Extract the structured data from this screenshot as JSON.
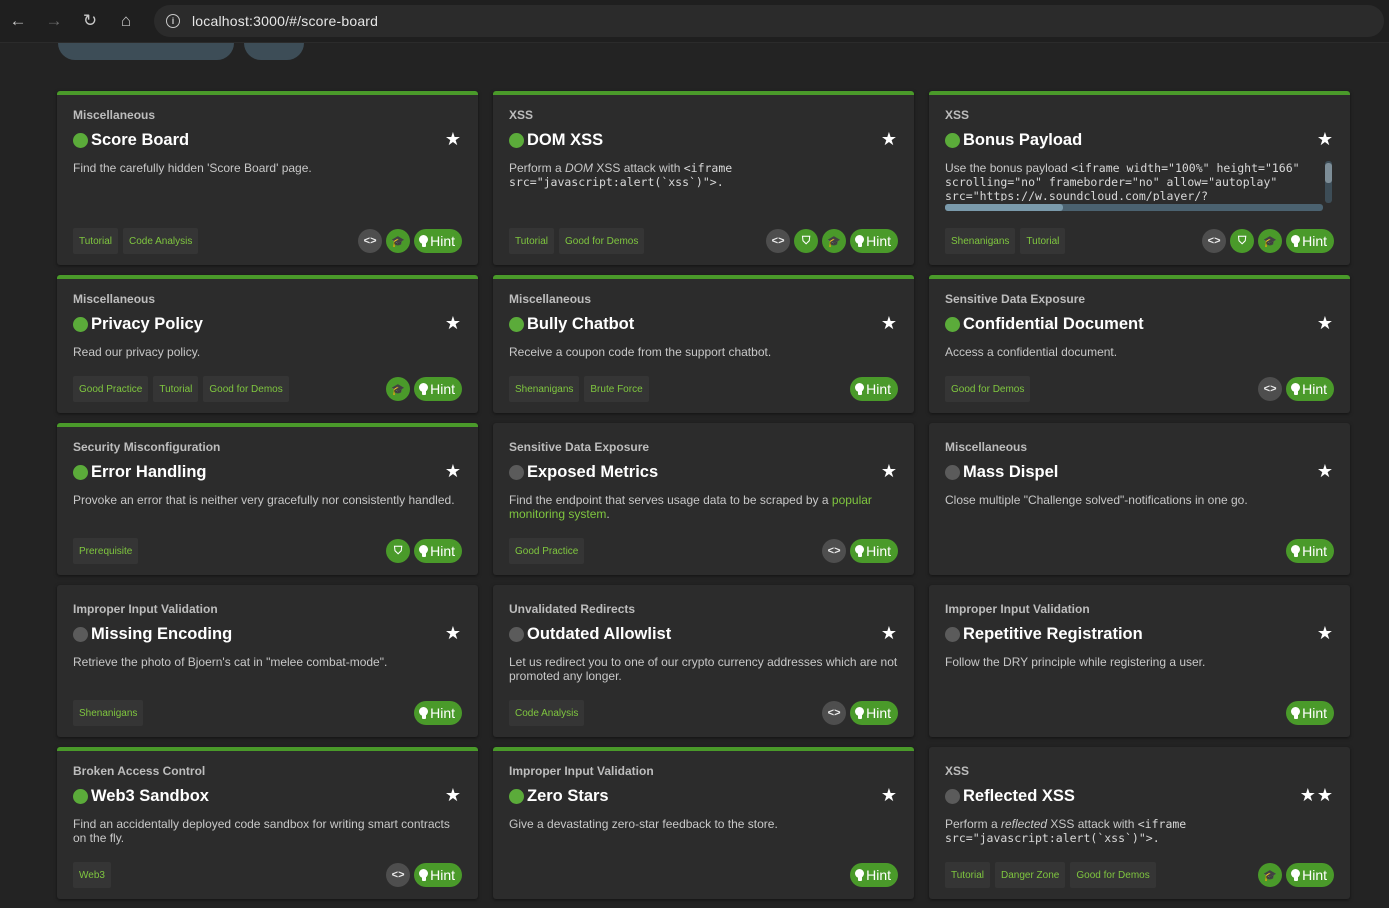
{
  "browser": {
    "back_icon": "←",
    "forward_icon": "→",
    "reload_icon": "↻",
    "home_icon": "⌂",
    "info_icon": "i",
    "url": "localhost:3000/#/score-board"
  },
  "colors": {
    "solved_accent": "#4a9a2a",
    "tag_text": "#7fc63f",
    "card_bg": "#2c2c2c",
    "page_bg": "#232323"
  },
  "hint_label": "Hint",
  "challenges": [
    {
      "category": "Miscellaneous",
      "title": "Score Board",
      "solved": true,
      "stars": "★",
      "description": "Find the carefully hidden 'Score Board' page.",
      "tags": [
        "Tutorial",
        "Code Analysis"
      ],
      "actions": [
        "code-icon",
        "graduation-cap-icon"
      ]
    },
    {
      "category": "XSS",
      "title": "DOM XSS",
      "solved": true,
      "stars": "★",
      "description_parts": [
        "Perform a ",
        "DOM",
        " XSS attack with ",
        "<iframe",
        "src=\"javascript:alert(`xss`)\">."
      ],
      "tags": [
        "Tutorial",
        "Good for Demos"
      ],
      "actions": [
        "code-icon",
        "mitigation-icon",
        "graduation-cap-icon"
      ]
    },
    {
      "category": "XSS",
      "title": "Bonus Payload",
      "solved": true,
      "stars": "★",
      "description_parts": [
        "Use the bonus payload ",
        "<iframe width=\"100%\" height=\"166\"",
        "scrolling=\"no\" frameborder=\"no\" allow=\"autoplay\"",
        "src=\"https://w.soundcloud.com/player/?"
      ],
      "tags": [
        "Shenanigans",
        "Tutorial"
      ],
      "actions": [
        "code-icon",
        "mitigation-icon",
        "graduation-cap-icon"
      ]
    },
    {
      "category": "Miscellaneous",
      "title": "Privacy Policy",
      "solved": true,
      "stars": "★",
      "description": "Read our privacy policy.",
      "tags": [
        "Good Practice",
        "Tutorial",
        "Good for Demos"
      ],
      "actions": [
        "graduation-cap-icon"
      ]
    },
    {
      "category": "Miscellaneous",
      "title": "Bully Chatbot",
      "solved": true,
      "stars": "★",
      "description": "Receive a coupon code from the support chatbot.",
      "tags": [
        "Shenanigans",
        "Brute Force"
      ],
      "actions": []
    },
    {
      "category": "Sensitive Data Exposure",
      "title": "Confidential Document",
      "solved": true,
      "stars": "★",
      "description": "Access a confidential document.",
      "tags": [
        "Good for Demos"
      ],
      "actions": [
        "code-icon"
      ]
    },
    {
      "category": "Security Misconfiguration",
      "title": "Error Handling",
      "solved": true,
      "stars": "★",
      "description": "Provoke an error that is neither very gracefully nor consistently handled.",
      "tags": [
        "Prerequisite"
      ],
      "actions": [
        "mitigation-icon"
      ]
    },
    {
      "category": "Sensitive Data Exposure",
      "title": "Exposed Metrics",
      "solved": false,
      "stars": "★",
      "description_parts": [
        "Find the endpoint that serves usage data to be scraped by a ",
        "popular monitoring system",
        "."
      ],
      "tags": [
        "Good Practice"
      ],
      "actions": [
        "code-icon"
      ]
    },
    {
      "category": "Miscellaneous",
      "title": "Mass Dispel",
      "solved": false,
      "stars": "★",
      "description": "Close multiple \"Challenge solved\"-notifications in one go.",
      "tags": [],
      "actions": []
    },
    {
      "category": "Improper Input Validation",
      "title": "Missing Encoding",
      "solved": false,
      "stars": "★",
      "description": "Retrieve the photo of Bjoern's cat in \"melee combat-mode\".",
      "tags": [
        "Shenanigans"
      ],
      "actions": []
    },
    {
      "category": "Unvalidated Redirects",
      "title": "Outdated Allowlist",
      "solved": false,
      "stars": "★",
      "description": "Let us redirect you to one of our crypto currency addresses which are not promoted any longer.",
      "tags": [
        "Code Analysis"
      ],
      "actions": [
        "code-icon"
      ]
    },
    {
      "category": "Improper Input Validation",
      "title": "Repetitive Registration",
      "solved": false,
      "stars": "★",
      "description": "Follow the DRY principle while registering a user.",
      "tags": [],
      "actions": []
    },
    {
      "category": "Broken Access Control",
      "title": "Web3 Sandbox",
      "solved": true,
      "stars": "★",
      "description": "Find an accidentally deployed code sandbox for writing smart contracts on the fly.",
      "tags": [
        "Web3"
      ],
      "actions": [
        "code-icon"
      ]
    },
    {
      "category": "Improper Input Validation",
      "title": "Zero Stars",
      "solved": true,
      "stars": "★",
      "description": "Give a devastating zero-star feedback to the store.",
      "tags": [],
      "actions": []
    },
    {
      "category": "XSS",
      "title": "Reflected XSS",
      "solved": false,
      "stars": "★★",
      "description_parts": [
        "Perform a ",
        "reflected",
        " XSS attack with ",
        "<iframe",
        "src=\"javascript:alert(`xss`)\">."
      ],
      "tags": [
        "Tutorial",
        "Danger Zone",
        "Good for Demos"
      ],
      "actions": [
        "graduation-cap-icon"
      ]
    }
  ]
}
